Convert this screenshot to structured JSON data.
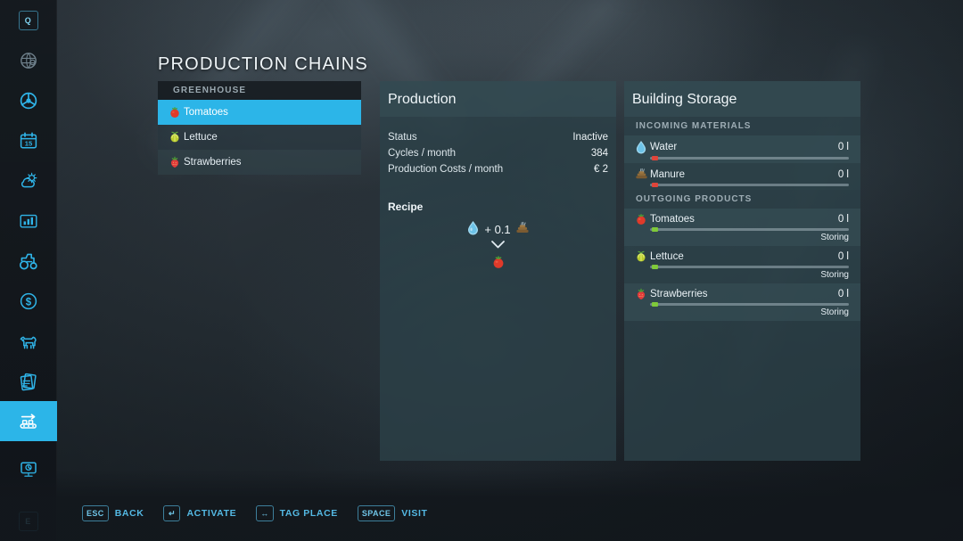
{
  "theme": {
    "accent": "#2cb5e8",
    "panel_bg": "#2c4148",
    "text": "#eef4f7",
    "muted": "#9aa8b0",
    "bar_red": "#e0453a",
    "bar_green": "#7fc93a"
  },
  "page_title": "PRODUCTION CHAINS",
  "sidebar": {
    "items": [
      {
        "icon": "key-q-icon",
        "label": "Q",
        "active": false,
        "dim": false
      },
      {
        "icon": "globe-map-icon",
        "label": "Map",
        "active": false,
        "dim": true
      },
      {
        "icon": "steering-wheel-icon",
        "label": "Vehicles",
        "active": false,
        "dim": false
      },
      {
        "icon": "calendar-15-icon",
        "label": "Calendar",
        "active": false,
        "dim": false
      },
      {
        "icon": "weather-icon",
        "label": "Weather",
        "active": false,
        "dim": false
      },
      {
        "icon": "statistics-icon",
        "label": "Statistics",
        "active": false,
        "dim": false
      },
      {
        "icon": "tractor-icon",
        "label": "Vehicle Overview",
        "active": false,
        "dim": false
      },
      {
        "icon": "dollar-finances-icon",
        "label": "Finances",
        "active": false,
        "dim": false
      },
      {
        "icon": "animal-cow-icon",
        "label": "Animals",
        "active": false,
        "dim": false
      },
      {
        "icon": "contracts-icon",
        "label": "Contracts",
        "active": false,
        "dim": false
      },
      {
        "icon": "production-chains-icon",
        "label": "Production Chains",
        "active": true,
        "dim": false
      },
      {
        "icon": "construction-icon",
        "label": "Construction",
        "active": false,
        "dim": false
      },
      {
        "icon": "key-e-icon",
        "label": "E",
        "active": false,
        "dim": false
      }
    ]
  },
  "list_panel": {
    "header": "GREENHOUSE",
    "rows": [
      {
        "icon": "tomato-icon",
        "label": "Tomatoes",
        "selected": true
      },
      {
        "icon": "lettuce-icon",
        "label": "Lettuce",
        "selected": false
      },
      {
        "icon": "strawberry-icon",
        "label": "Strawberries",
        "selected": false
      }
    ]
  },
  "production": {
    "title": "Production",
    "stats": [
      {
        "label": "Status",
        "value": "Inactive"
      },
      {
        "label": "Cycles / month",
        "value": "384"
      },
      {
        "label": "Production Costs / month",
        "value": "€ 2"
      }
    ],
    "recipe_title": "Recipe",
    "recipe": {
      "inputs": [
        {
          "icon": "water-drop-icon",
          "amount": ""
        },
        {
          "icon": "plus-sign",
          "amount": "+"
        },
        {
          "icon": "manure-icon",
          "amount": "0.1"
        }
      ],
      "input_text": "+ 0.1",
      "arrow": "chevron-down-icon",
      "output": {
        "icon": "tomato-icon",
        "label": "Tomatoes"
      }
    }
  },
  "storage": {
    "title": "Building Storage",
    "sections": [
      {
        "label": "INCOMING MATERIALS",
        "rows": [
          {
            "icon": "water-drop-icon",
            "name": "Water",
            "amount": "0 l",
            "fill_color": "#e0453a",
            "status": ""
          },
          {
            "icon": "manure-icon",
            "name": "Manure",
            "amount": "0 l",
            "fill_color": "#e0453a",
            "status": ""
          }
        ]
      },
      {
        "label": "OUTGOING PRODUCTS",
        "rows": [
          {
            "icon": "tomato-icon",
            "name": "Tomatoes",
            "amount": "0 l",
            "fill_color": "#7fc93a",
            "status": "Storing"
          },
          {
            "icon": "lettuce-icon",
            "name": "Lettuce",
            "amount": "0 l",
            "fill_color": "#7fc93a",
            "status": "Storing"
          },
          {
            "icon": "strawberry-icon",
            "name": "Strawberries",
            "amount": "0 l",
            "fill_color": "#7fc93a",
            "status": "Storing"
          }
        ]
      }
    ]
  },
  "footer": {
    "keybinds": [
      {
        "key": "ESC",
        "icon": "esc-key-icon",
        "label": "BACK"
      },
      {
        "key": "↵",
        "icon": "enter-key-icon",
        "label": "ACTIVATE"
      },
      {
        "key": "↔",
        "icon": "leftright-key-icon",
        "label": "TAG PLACE"
      },
      {
        "key": "SPACE",
        "icon": "space-key-icon",
        "label": "VISIT"
      }
    ]
  }
}
